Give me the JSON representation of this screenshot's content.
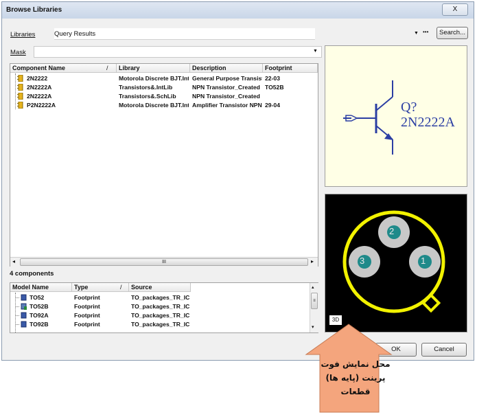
{
  "window": {
    "title": "Browse Libraries",
    "close_label": "X"
  },
  "libraries": {
    "label": "Libraries",
    "value": "Query Results",
    "more_label": "•••",
    "search_label": "Search..."
  },
  "mask": {
    "label": "Mask",
    "value": ""
  },
  "components": {
    "headers": [
      "Component Name",
      "Library",
      "Description",
      "Footprint"
    ],
    "sort_glyph": "/",
    "rows": [
      {
        "name": "2N2222",
        "library": "Motorola Discrete BJT.IntLib",
        "description": "General Purpose Transistor",
        "footprint": "22-03"
      },
      {
        "name": "2N2222A",
        "library": "Transistors&.IntLib",
        "description": "NPN Transistor_Created",
        "footprint": "TO52B"
      },
      {
        "name": "2N2222A",
        "library": "Transistors&.SchLib",
        "description": "NPN Transistor_Created",
        "footprint": ""
      },
      {
        "name": "P2N2222A",
        "library": "Motorola Discrete BJT.IntLib",
        "description": "Amplifier Transistor NPN",
        "footprint": "29-04"
      }
    ],
    "scroll_thumb": "III",
    "count_label": "4 components"
  },
  "models": {
    "headers": [
      "Model Name",
      "Type",
      "Source"
    ],
    "sort_glyph": "/",
    "rows": [
      {
        "name": "TO52",
        "type": "Footprint",
        "source": "TO_packages_TR_IC"
      },
      {
        "name": "TO52B",
        "type": "Footprint",
        "source": "TO_packages_TR_IC"
      },
      {
        "name": "TO92A",
        "type": "Footprint",
        "source": "TO_packages_TR_IC"
      },
      {
        "name": "TO92B",
        "type": "Footprint",
        "source": "TO_packages_TR_IC"
      }
    ]
  },
  "symbol": {
    "designator": "Q?",
    "comment": "2N2222A"
  },
  "footprint": {
    "pads": [
      "2",
      "3",
      "1"
    ],
    "view_button": "3D"
  },
  "buttons": {
    "ok": "OK",
    "cancel": "Cancel"
  },
  "callout": {
    "text": "محل نمایش فوت پرینت (پایه ها) قطعات",
    "color": "#f4a57d"
  },
  "colors": {
    "symbol_blue": "#2b3ea3",
    "pad_gray": "#c8c8c8",
    "pad_number": "#1f8a8a",
    "silk_yellow": "#f2f200",
    "symbol_bg": "#ffffe6"
  }
}
